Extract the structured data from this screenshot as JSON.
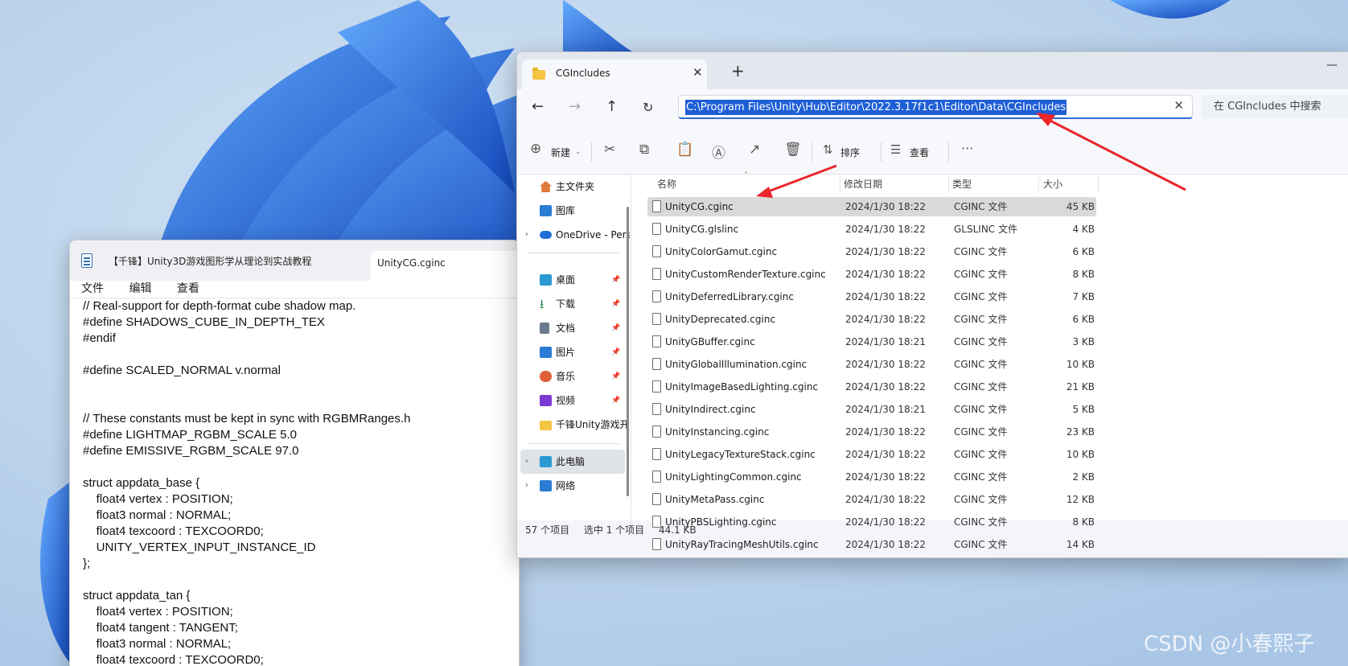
{
  "notepad": {
    "tab1": "【千锋】Unity3D游戏图形学从理论到实战教程",
    "tab2": "UnityCG.cginc",
    "menu": [
      "文件",
      "编辑",
      "查看"
    ],
    "code": "// Real-support for depth-format cube shadow map.\n#define SHADOWS_CUBE_IN_DEPTH_TEX\n#endif\n\n#define SCALED_NORMAL v.normal\n\n\n// These constants must be kept in sync with RGBMRanges.h\n#define LIGHTMAP_RGBM_SCALE 5.0\n#define EMISSIVE_RGBM_SCALE 97.0\n\nstruct appdata_base {\n    float4 vertex : POSITION;\n    float3 normal : NORMAL;\n    float4 texcoord : TEXCOORD0;\n    UNITY_VERTEX_INPUT_INSTANCE_ID\n};\n\nstruct appdata_tan {\n    float4 vertex : POSITION;\n    float4 tangent : TANGENT;\n    float3 normal : NORMAL;\n    float4 texcoord : TEXCOORD0;"
  },
  "explorer": {
    "tab_title": "CGIncludes",
    "address": "C:\\Program Files\\Unity\\Hub\\Editor\\2022.3.17f1c1\\Editor\\Data\\CGIncludes",
    "search_placeholder": "在 CGIncludes 中搜索",
    "toolbar": {
      "new": "新建",
      "sort": "排序",
      "view": "查看"
    },
    "nav": [
      {
        "label": "主文件夹",
        "icon": "home-icon",
        "color": "#e07a3a"
      },
      {
        "label": "图库",
        "icon": "gallery-icon",
        "color": "#2b7cd3"
      },
      {
        "label": "OneDrive - Personal",
        "icon": "cloud-icon",
        "color": "#1e6fd6"
      },
      {
        "label": "桌面",
        "icon": "desktop-icon",
        "color": "#2b9ad3"
      },
      {
        "label": "下载",
        "icon": "download-icon",
        "color": "#1d8a4a"
      },
      {
        "label": "文档",
        "icon": "documents-icon",
        "color": "#6b7a8f"
      },
      {
        "label": "图片",
        "icon": "pictures-icon",
        "color": "#2b7cd3"
      },
      {
        "label": "音乐",
        "icon": "music-icon",
        "color": "#e0603a"
      },
      {
        "label": "视频",
        "icon": "video-icon",
        "color": "#7a3ad3"
      },
      {
        "label": "千锋Unity游戏开发",
        "icon": "folder-icon",
        "color": "#f4c442"
      },
      {
        "label": "此电脑",
        "icon": "pc-icon",
        "color": "#2b9ad3"
      },
      {
        "label": "网络",
        "icon": "network-icon",
        "color": "#2b7cd3"
      }
    ],
    "columns": {
      "name": "名称",
      "date": "修改日期",
      "type": "类型",
      "size": "大小"
    },
    "files": [
      {
        "name": "UnityCG.cginc",
        "date": "2024/1/30 18:22",
        "type": "CGINC 文件",
        "size": "45 KB"
      },
      {
        "name": "UnityCG.glslinc",
        "date": "2024/1/30 18:22",
        "type": "GLSLINC 文件",
        "size": "4 KB"
      },
      {
        "name": "UnityColorGamut.cginc",
        "date": "2024/1/30 18:22",
        "type": "CGINC 文件",
        "size": "6 KB"
      },
      {
        "name": "UnityCustomRenderTexture.cginc",
        "date": "2024/1/30 18:22",
        "type": "CGINC 文件",
        "size": "8 KB"
      },
      {
        "name": "UnityDeferredLibrary.cginc",
        "date": "2024/1/30 18:22",
        "type": "CGINC 文件",
        "size": "7 KB"
      },
      {
        "name": "UnityDeprecated.cginc",
        "date": "2024/1/30 18:22",
        "type": "CGINC 文件",
        "size": "6 KB"
      },
      {
        "name": "UnityGBuffer.cginc",
        "date": "2024/1/30 18:21",
        "type": "CGINC 文件",
        "size": "3 KB"
      },
      {
        "name": "UnityGlobalIllumination.cginc",
        "date": "2024/1/30 18:22",
        "type": "CGINC 文件",
        "size": "10 KB"
      },
      {
        "name": "UnityImageBasedLighting.cginc",
        "date": "2024/1/30 18:22",
        "type": "CGINC 文件",
        "size": "21 KB"
      },
      {
        "name": "UnityIndirect.cginc",
        "date": "2024/1/30 18:21",
        "type": "CGINC 文件",
        "size": "5 KB"
      },
      {
        "name": "UnityInstancing.cginc",
        "date": "2024/1/30 18:22",
        "type": "CGINC 文件",
        "size": "23 KB"
      },
      {
        "name": "UnityLegacyTextureStack.cginc",
        "date": "2024/1/30 18:22",
        "type": "CGINC 文件",
        "size": "10 KB"
      },
      {
        "name": "UnityLightingCommon.cginc",
        "date": "2024/1/30 18:22",
        "type": "CGINC 文件",
        "size": "2 KB"
      },
      {
        "name": "UnityMetaPass.cginc",
        "date": "2024/1/30 18:22",
        "type": "CGINC 文件",
        "size": "12 KB"
      },
      {
        "name": "UnityPBSLighting.cginc",
        "date": "2024/1/30 18:22",
        "type": "CGINC 文件",
        "size": "8 KB"
      },
      {
        "name": "UnityRayTracingMeshUtils.cginc",
        "date": "2024/1/30 18:22",
        "type": "CGINC 文件",
        "size": "14 KB"
      }
    ],
    "status": {
      "count": "57 个项目",
      "selected": "选中 1 个项目",
      "size": "44.1 KB"
    }
  },
  "watermark": "CSDN @小春熙子",
  "colors": {
    "accent": "#1e5fd6",
    "annotation_arrow": "#e8262b"
  }
}
